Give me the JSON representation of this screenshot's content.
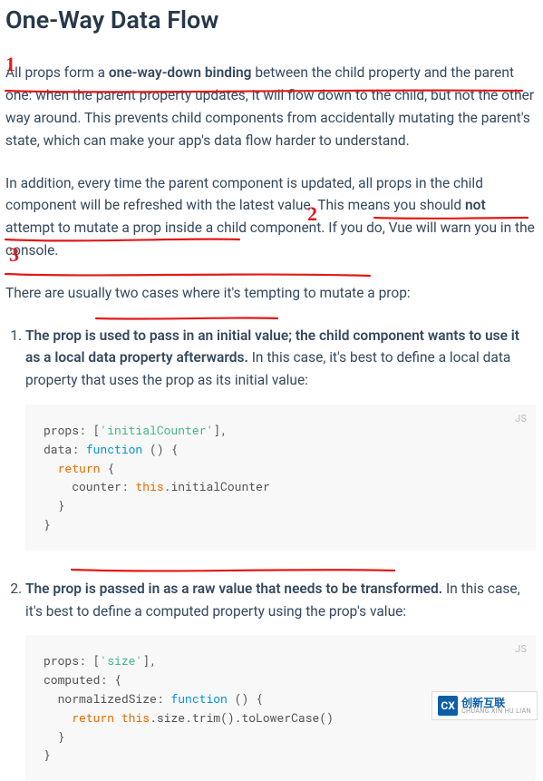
{
  "heading": "One-Way Data Flow",
  "para1": {
    "a": "All props form a ",
    "b": "one-way-down binding",
    "c": " between the child property and the parent one: when the parent property updates, it will flow down to the child, but not the other way around. This prevents child components from accidentally mutating the parent's state, which can make your app's data flow harder to understand."
  },
  "para2": {
    "a": "In addition, every time the parent component is updated, all props in the child component will be refreshed with the latest value. This means you should ",
    "b": "not",
    "c": " attempt to mutate a prop inside a child component. If you do, Vue will warn you in the console."
  },
  "para3": "There are usually two cases where it's tempting to mutate a prop:",
  "item1": {
    "bold": "The prop is used to pass in an initial value; the child component wants to use it as a local data property afterwards.",
    "rest": " In this case, it's best to define a local data property that uses the prop as its initial value:"
  },
  "item2": {
    "bold": "The prop is passed in as a raw value that needs to be transformed.",
    "rest": " In this case, it's best to define a computed property using the prop's value:"
  },
  "code1": {
    "lang": "JS",
    "l1a": "props: [",
    "l1b": "'initialCounter'",
    "l1c": "],",
    "l2a": "data: ",
    "l2b": "function",
    "l2c": " () {",
    "l3a": "  ",
    "l3b": "return",
    "l3c": " {",
    "l4a": "    counter: ",
    "l4b": "this",
    "l4c": ".initialCounter",
    "l5": "  }",
    "l6": "}"
  },
  "code2": {
    "lang": "JS",
    "l1a": "props: [",
    "l1b": "'size'",
    "l1c": "],",
    "l2": "computed: {",
    "l3a": "  normalizedSize: ",
    "l3b": "function",
    "l3c": " () {",
    "l4a": "    ",
    "l4b": "return",
    "l4c": " ",
    "l4d": "this",
    "l4e": ".size.trim().toLowerCase()",
    "l5": "  }",
    "l6": "}"
  },
  "annotations": {
    "n1": "1",
    "n2": "2",
    "n3": "3"
  },
  "watermark": {
    "brand": "创新互联",
    "sub": "CHUANG XIN HU LIAN",
    "logo": "CX"
  }
}
